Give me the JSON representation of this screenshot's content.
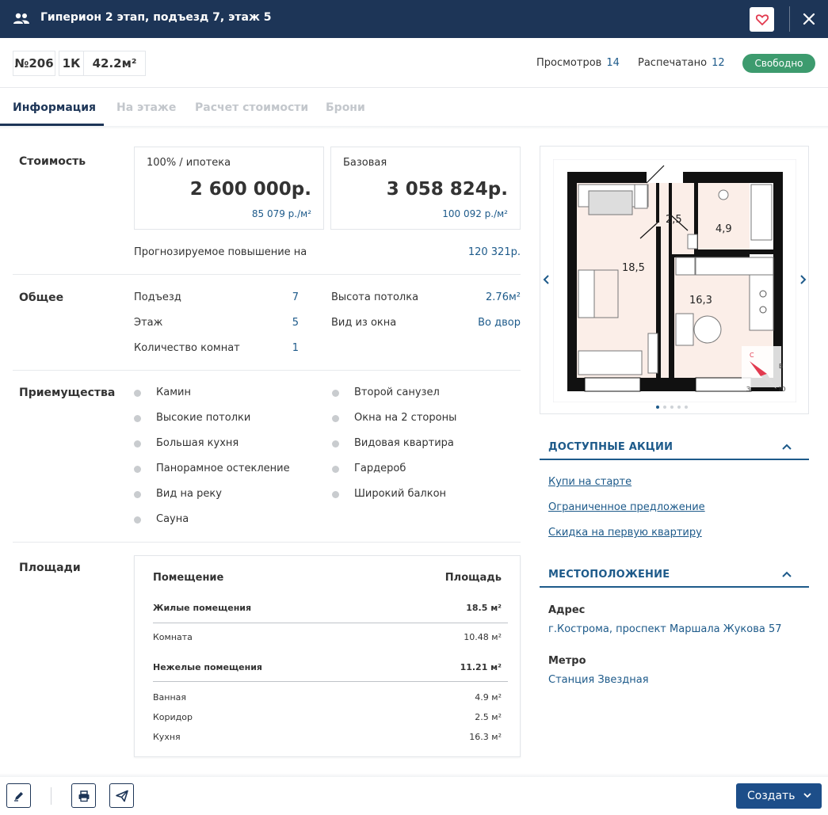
{
  "header": {
    "title": "Гиперион 2 этап, подъезд 7, этаж 5"
  },
  "apartment": {
    "number": "№206",
    "type": "1К",
    "area": "42.2м²"
  },
  "stats": {
    "views_label": "Просмотров",
    "views": "14",
    "printed_label": "Распечатано",
    "printed": "12"
  },
  "status": {
    "label": "Свободно",
    "color": "#3d9b6e"
  },
  "tabs": [
    {
      "label": "Информация",
      "active": true
    },
    {
      "label": "На этаже",
      "active": false
    },
    {
      "label": "Расчет стоимости",
      "active": false
    },
    {
      "label": "Брони",
      "active": false
    }
  ],
  "cost": {
    "section": "Стоимость",
    "cards": [
      {
        "label": "100% / ипотека",
        "price": "2 600 000р.",
        "per_sqm": "85 079 р./м²"
      },
      {
        "label": "Базовая",
        "price": "3 058 824р.",
        "per_sqm": "100 092 р./м²"
      }
    ],
    "forecast_label": "Прогнозируемое повышение на",
    "forecast_value": "120 321р."
  },
  "general": {
    "section": "Общее",
    "left": [
      {
        "label": "Подъезд",
        "value": "7"
      },
      {
        "label": "Этаж",
        "value": "5"
      },
      {
        "label": "Количество комнат",
        "value": "1"
      }
    ],
    "right": [
      {
        "label": "Высота потолка",
        "value": "2.76м²"
      },
      {
        "label": "Вид из окна",
        "value": "Во двор"
      }
    ]
  },
  "advantages": {
    "section": "Приемущества",
    "left": [
      "Камин",
      "Высокие потолки",
      "Большая кухня",
      "Панорамное остекление",
      "Вид на реку",
      "Сауна"
    ],
    "right": [
      "Второй санузел",
      "Окна на 2 стороны",
      "Видовая квартира",
      "Гардероб",
      "Широкий балкон"
    ]
  },
  "areas": {
    "section": "Площади",
    "col_room": "Помещение",
    "col_area": "Площадь",
    "groups": [
      {
        "name": "Жилые помещения",
        "total": "18.5 м²",
        "items": [
          {
            "name": "Комната",
            "area": "10.48 м²"
          }
        ]
      },
      {
        "name": "Нежелые помещения",
        "total": "11.21 м²",
        "items": [
          {
            "name": "Ванная",
            "area": "4.9 м²"
          },
          {
            "name": "Коридор",
            "area": "2.5 м²"
          },
          {
            "name": "Кухня",
            "area": "16.3 м²"
          }
        ]
      }
    ]
  },
  "plan": {
    "labels": {
      "room": "18,5",
      "corridor": "2,5",
      "bath": "4,9",
      "kitchen": "16,3"
    },
    "compass": {
      "n": "С",
      "e": "В",
      "s": "Ю",
      "w": "З"
    },
    "slides_total": 5,
    "slide_active": 0
  },
  "promotions": {
    "title": "ДОСТУПНЫЕ АКЦИИ",
    "items": [
      "Купи на старте",
      "Ограниченное предложение",
      "Скидка на первую квартиру"
    ]
  },
  "location": {
    "title": "МЕСТОПОЛОЖЕНИЕ",
    "address_label": "Адрес",
    "address": "г.Кострома, проспект Маршала Жукова 57",
    "metro_label": "Метро",
    "metro": "Станция Звездная"
  },
  "footer": {
    "create_label": "Создать"
  },
  "colors": {
    "header_bg": "#1d3557",
    "accent": "#1d5a8a",
    "primary_btn": "#1d4e89"
  }
}
